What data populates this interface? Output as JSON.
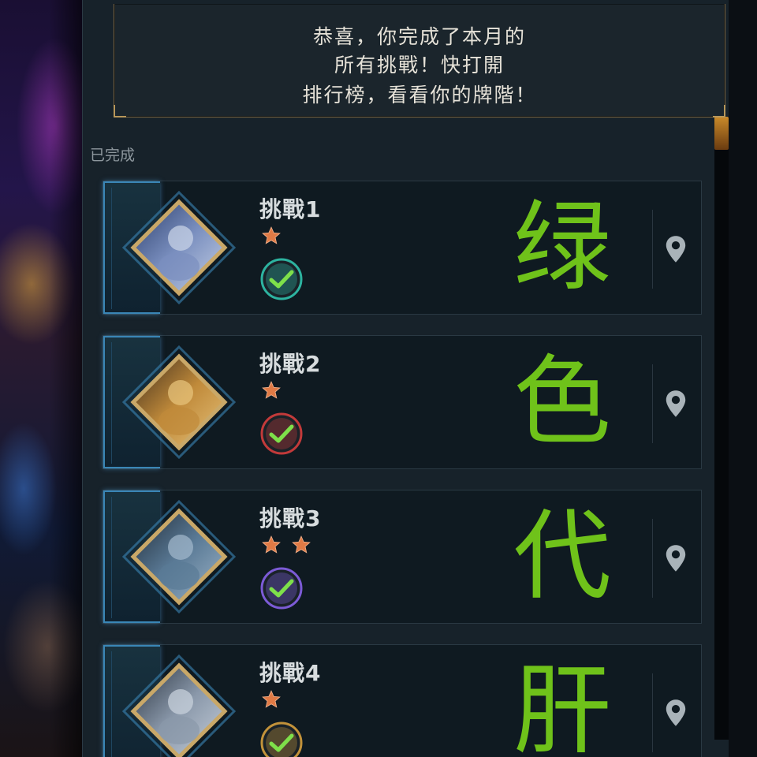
{
  "notice": {
    "lines": [
      "恭喜，你完成了本月的",
      "所有挑戰！快打開",
      "排行榜，看看你的牌階！"
    ]
  },
  "section_label": "已完成",
  "challenges": [
    {
      "title": "挑戰1",
      "stars": 1,
      "overlay_char": "绿",
      "badge_color": "#2db3a0"
    },
    {
      "title": "挑戰2",
      "stars": 1,
      "overlay_char": "色",
      "badge_color": "#c23a3a"
    },
    {
      "title": "挑戰3",
      "stars": 2,
      "overlay_char": "代",
      "badge_color": "#7c5bd6"
    },
    {
      "title": "挑戰4",
      "stars": 1,
      "overlay_char": "肝",
      "badge_color": "#c2923a"
    }
  ],
  "colors": {
    "overlay_text": "#6fc21a",
    "check": "#7ee04a",
    "star": "#e07a45",
    "frame_gold": "#c9a868",
    "tab_blue": "#3a86b6"
  },
  "icons": {
    "location": "location-pin-icon",
    "check": "checkmark-icon",
    "star": "star-icon"
  }
}
